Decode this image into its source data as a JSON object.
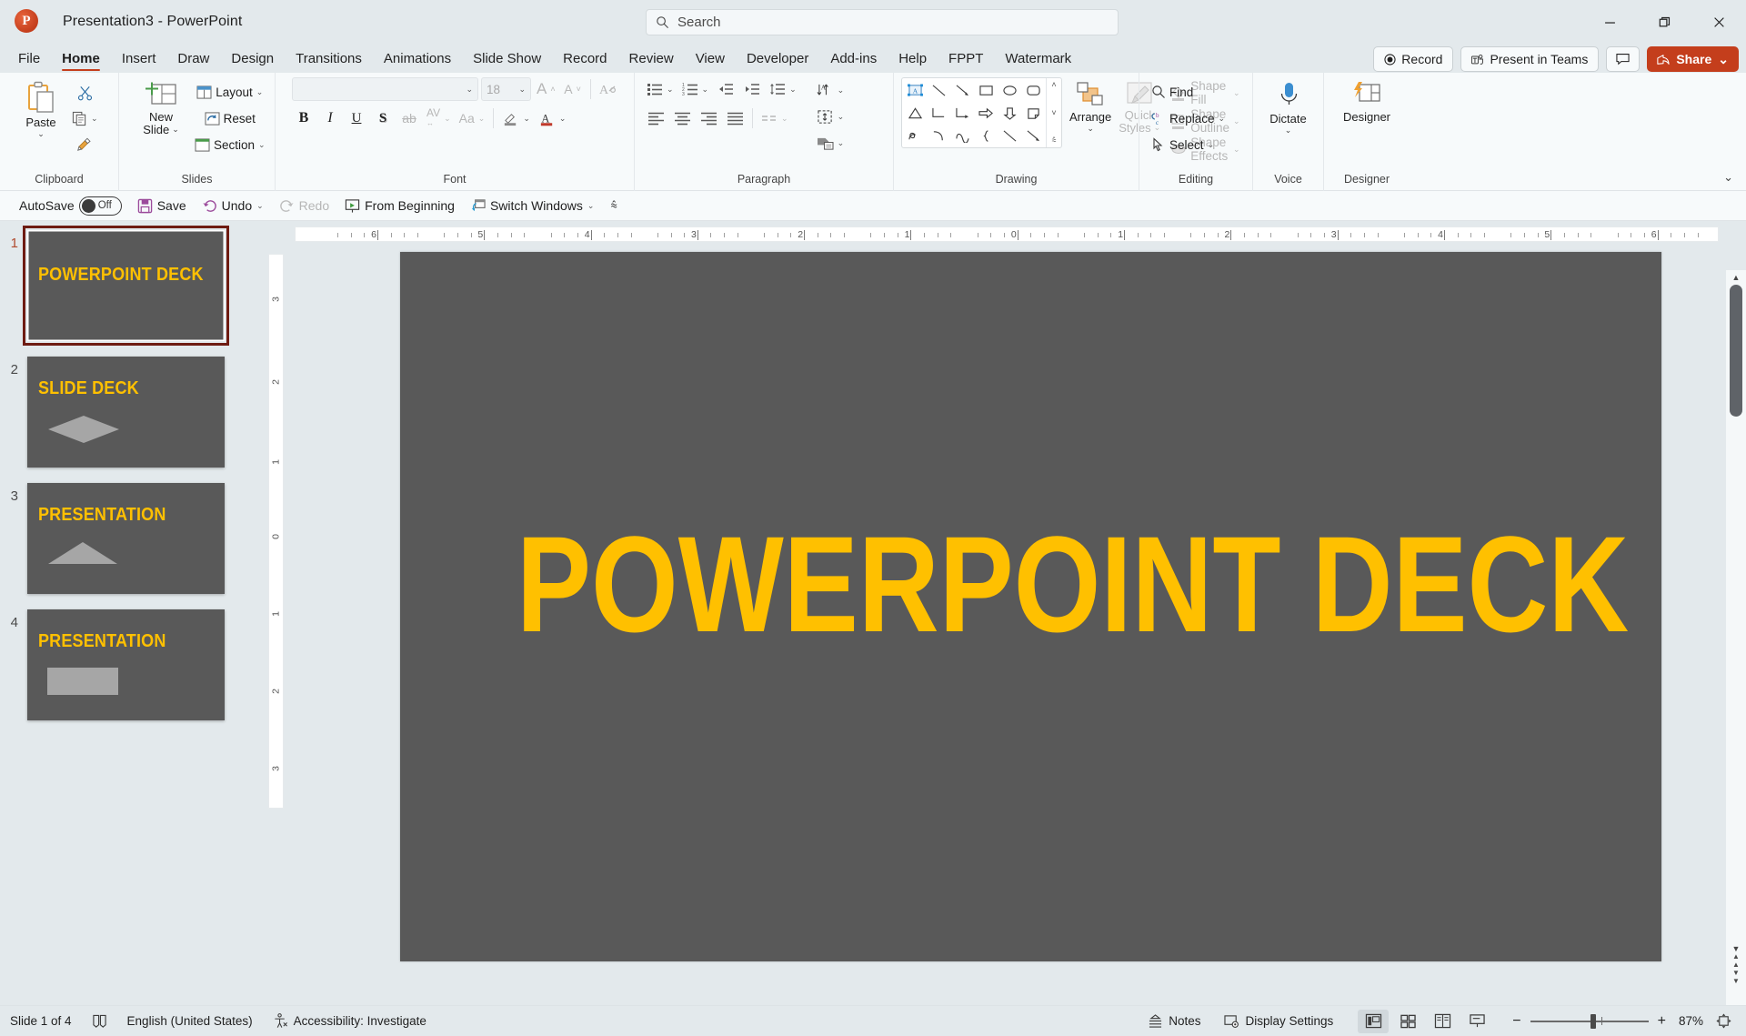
{
  "window": {
    "title": "Presentation3  -  PowerPoint",
    "app_icon": "powerpoint-icon",
    "minimize": "–",
    "restore": "❐",
    "close": "✕"
  },
  "search": {
    "placeholder": "Search",
    "icon": "search-icon"
  },
  "ribbon": {
    "tabs": [
      {
        "label": "File",
        "active": false
      },
      {
        "label": "Home",
        "active": true
      },
      {
        "label": "Insert",
        "active": false
      },
      {
        "label": "Draw",
        "active": false
      },
      {
        "label": "Design",
        "active": false
      },
      {
        "label": "Transitions",
        "active": false
      },
      {
        "label": "Animations",
        "active": false
      },
      {
        "label": "Slide Show",
        "active": false
      },
      {
        "label": "Record",
        "active": false
      },
      {
        "label": "Review",
        "active": false
      },
      {
        "label": "View",
        "active": false
      },
      {
        "label": "Developer",
        "active": false
      },
      {
        "label": "Add-ins",
        "active": false
      },
      {
        "label": "Help",
        "active": false
      },
      {
        "label": "FPPT",
        "active": false
      },
      {
        "label": "Watermark",
        "active": false
      }
    ],
    "right_buttons": {
      "record": "Record",
      "present_in_teams": "Present in Teams",
      "comments": "comments-icon",
      "share": "Share",
      "share_caret": "⌄"
    },
    "collapse_caret": "⌄",
    "groups": {
      "clipboard": {
        "label": "Clipboard",
        "paste": "Paste",
        "paste_caret": "⌄",
        "cut": "cut-icon",
        "copy": "copy-icon",
        "copy_caret": "⌄",
        "format_painter": "format-painter-icon",
        "launcher": "◲"
      },
      "slides": {
        "label": "Slides",
        "new_slide": "New\nSlide",
        "new_slide_line1": "New",
        "new_slide_line2": "Slide",
        "new_slide_caret": "⌄",
        "layout": "Layout",
        "layout_caret": "⌄",
        "reset": "Reset",
        "section": "Section",
        "section_caret": "⌄"
      },
      "font": {
        "label": "Font",
        "font_name_value": "",
        "font_name_caret": "⌄",
        "font_size_value": "18",
        "font_size_caret": "⌄",
        "increase_font": "A",
        "decrease_font": "A",
        "clear_formatting": "clear-formatting-icon",
        "bold": "B",
        "italic": "I",
        "underline": "U",
        "shadow": "S",
        "strikethrough": "ab",
        "character_spacing": "AV",
        "change_case": "Aa",
        "text_highlight": "highlight-icon",
        "font_color": "A",
        "launcher": "◲"
      },
      "paragraph": {
        "label": "Paragraph",
        "bullets": "bullets-icon",
        "numbering": "numbering-icon",
        "decrease_indent": "decrease-indent-icon",
        "increase_indent": "increase-indent-icon",
        "line_spacing": "line-spacing-icon",
        "align_left": "align-left-icon",
        "align_center": "align-center-icon",
        "align_right": "align-right-icon",
        "justify": "justify-icon",
        "columns": "columns-icon",
        "text_direction": "text-direction-icon",
        "align_text": "align-text-icon",
        "convert_to_smartart": "smartart-icon",
        "launcher": "◲"
      },
      "drawing": {
        "label": "Drawing",
        "arrange": "Arrange",
        "arrange_caret": "⌄",
        "quick_styles_line1": "Quick",
        "quick_styles_line2": "Styles",
        "quick_styles_caret": "⌄",
        "shape_fill": "Shape Fill",
        "shape_outline": "Shape Outline",
        "shape_effects": "Shape Effects",
        "caret": "⌄",
        "launcher": "◲"
      },
      "editing": {
        "label": "Editing",
        "find": "Find",
        "replace": "Replace",
        "replace_caret": "⌄",
        "select": "Select",
        "select_caret": "⌄"
      },
      "voice": {
        "label": "Voice",
        "dictate": "Dictate",
        "dictate_caret": "⌄"
      },
      "designer": {
        "label": "Designer",
        "designer": "Designer"
      }
    }
  },
  "quick_access": {
    "autosave_label": "AutoSave",
    "autosave_state": "Off",
    "save": "Save",
    "undo": "Undo",
    "undo_caret": "⌄",
    "redo": "Redo",
    "from_beginning": "From Beginning",
    "switch_windows": "Switch Windows",
    "switch_windows_caret": "⌄",
    "customize_caret": "⌅"
  },
  "thumbnails": [
    {
      "number": "1",
      "title": "POWERPOINT DECK",
      "shape": "none",
      "selected": true
    },
    {
      "number": "2",
      "title": "SLIDE DECK",
      "shape": "diamond",
      "selected": false
    },
    {
      "number": "3",
      "title": "PRESENTATION",
      "shape": "triangle",
      "selected": false
    },
    {
      "number": "4",
      "title": "PRESENTATION",
      "shape": "rectangle",
      "selected": false
    }
  ],
  "rulers": {
    "horizontal_ticks": [
      "6",
      "5",
      "4",
      "3",
      "2",
      "1",
      "0",
      "1",
      "2",
      "3",
      "4",
      "5",
      "6"
    ],
    "vertical_ticks": [
      "3",
      "2",
      "1",
      "0",
      "1",
      "2",
      "3"
    ]
  },
  "slide": {
    "title": "POWERPOINT DECK",
    "background_color": "#595959",
    "title_color": "#FFC000"
  },
  "status_bar": {
    "slide_indicator": "Slide 1 of 4",
    "spellcheck_icon": "spellcheck-icon",
    "language": "English (United States)",
    "accessibility": "Accessibility: Investigate",
    "notes": "Notes",
    "display_settings": "Display Settings",
    "view_normal": "normal-view-icon",
    "view_sorter": "slide-sorter-icon",
    "view_reading": "reading-view-icon",
    "view_slideshow": "slideshow-view-icon",
    "zoom_out": "−",
    "zoom_in": "+",
    "zoom_level": "87%",
    "fit_slide": "fit-to-window-icon"
  },
  "colors": {
    "accent_orange": "#c43e1c",
    "slide_gray": "#595959",
    "title_gold": "#FFC000",
    "chrome": "#e3e9ec"
  }
}
